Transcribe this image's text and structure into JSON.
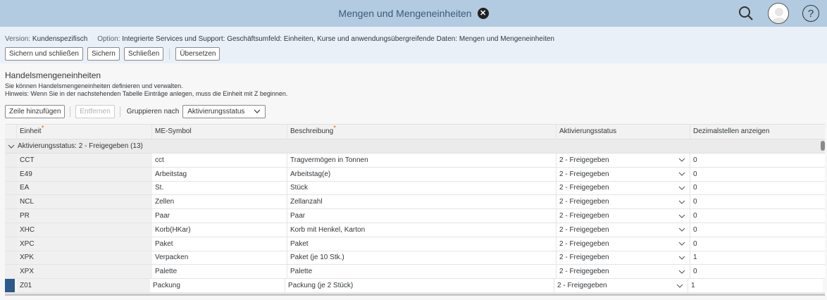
{
  "shell": {
    "title": "Mengen und Mengeneinheiten",
    "icons": [
      "close-icon",
      "search-icon",
      "user-avatar-icon",
      "help-icon"
    ]
  },
  "info": {
    "version_label": "Version:",
    "version_value": "Kundenspezifisch",
    "option_label": "Option:",
    "option_value": "Integrierte Services und Support: Geschäftsumfeld: Einheiten, Kurse und anwendungsübergreifende Daten: Mengen und Mengeneinheiten"
  },
  "toolbar": {
    "save_close": "Sichern und schließen",
    "save": "Sichern",
    "close": "Schließen",
    "translate": "Übersetzen"
  },
  "section": {
    "title": "Handelsmengeneinheiten",
    "desc1": "Sie können Handelsmengeneinheiten definieren und verwalten.",
    "desc2": "Hinweis: Wenn Sie in der nachstehenden Tabelle Einträge anlegen, muss die Einheit mit Z beginnen."
  },
  "table_toolbar": {
    "add_row": "Zeile hinzufügen",
    "remove": "Entfernen",
    "group_by_label": "Gruppieren nach",
    "group_by_value": "Aktivierungsstatus"
  },
  "columns": {
    "unit": "Einheit",
    "symbol": "ME-Symbol",
    "description": "Beschreibung",
    "status": "Aktivierungsstatus",
    "decimals": "Dezimalstellen anzeigen"
  },
  "group": {
    "label": "Aktivierungsstatus: 2 - Freigegeben (13)"
  },
  "rows": [
    {
      "unit": "CCT",
      "symbol": "cct",
      "description": "Tragvermögen in Tonnen",
      "status": "2 - Freigegeben",
      "decimals": "0"
    },
    {
      "unit": "E49",
      "symbol": "Arbeitstag",
      "description": "Arbeitstag(e)",
      "status": "2 - Freigegeben",
      "decimals": "0"
    },
    {
      "unit": "EA",
      "symbol": "St.",
      "description": "Stück",
      "status": "2 - Freigegeben",
      "decimals": "0"
    },
    {
      "unit": "NCL",
      "symbol": "Zellen",
      "description": "Zellanzahl",
      "status": "2 - Freigegeben",
      "decimals": "0"
    },
    {
      "unit": "PR",
      "symbol": "Paar",
      "description": "Paar",
      "status": "2 - Freigegeben",
      "decimals": "0"
    },
    {
      "unit": "XHC",
      "symbol": "Korb(HKar)",
      "description": "Korb mit Henkel, Karton",
      "status": "2 - Freigegeben",
      "decimals": "0"
    },
    {
      "unit": "XPC",
      "symbol": "Paket",
      "description": "Paket",
      "status": "2 - Freigegeben",
      "decimals": "0"
    },
    {
      "unit": "XPK",
      "symbol": "Verpacken",
      "description": "Paket (je 10 Stk.)",
      "status": "2 - Freigegeben",
      "decimals": "1"
    },
    {
      "unit": "XPX",
      "symbol": "Palette",
      "description": "Palette",
      "status": "2 - Freigegeben",
      "decimals": "0"
    },
    {
      "unit": "Z01",
      "symbol": "Packung",
      "description": "Packung (je 2 Stück)",
      "status": "2 - Freigegeben",
      "decimals": "1"
    }
  ]
}
